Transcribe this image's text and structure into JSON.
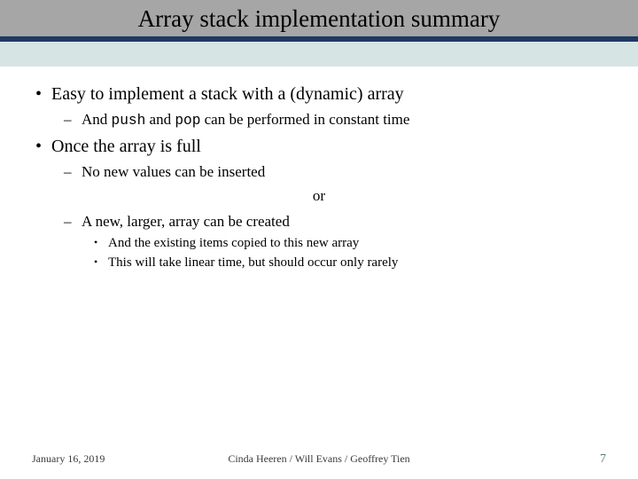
{
  "title": "Array stack implementation summary",
  "bullets": {
    "b1": "Easy to implement a stack with a (dynamic) array",
    "b1_1_pre": "And ",
    "b1_1_code1": "push",
    "b1_1_mid": " and ",
    "b1_1_code2": "pop",
    "b1_1_post": " can be performed in constant time",
    "b2": "Once the array is full",
    "b2_1": "No new values can be inserted",
    "or": "or",
    "b2_2": "A new, larger, array can be created",
    "b2_2_1": "And the existing items copied to this new array",
    "b2_2_2": "This will take linear time, but should occur only rarely"
  },
  "footer": {
    "date": "January 16, 2019",
    "authors": "Cinda Heeren / Will Evans / Geoffrey Tien",
    "page": "7"
  }
}
